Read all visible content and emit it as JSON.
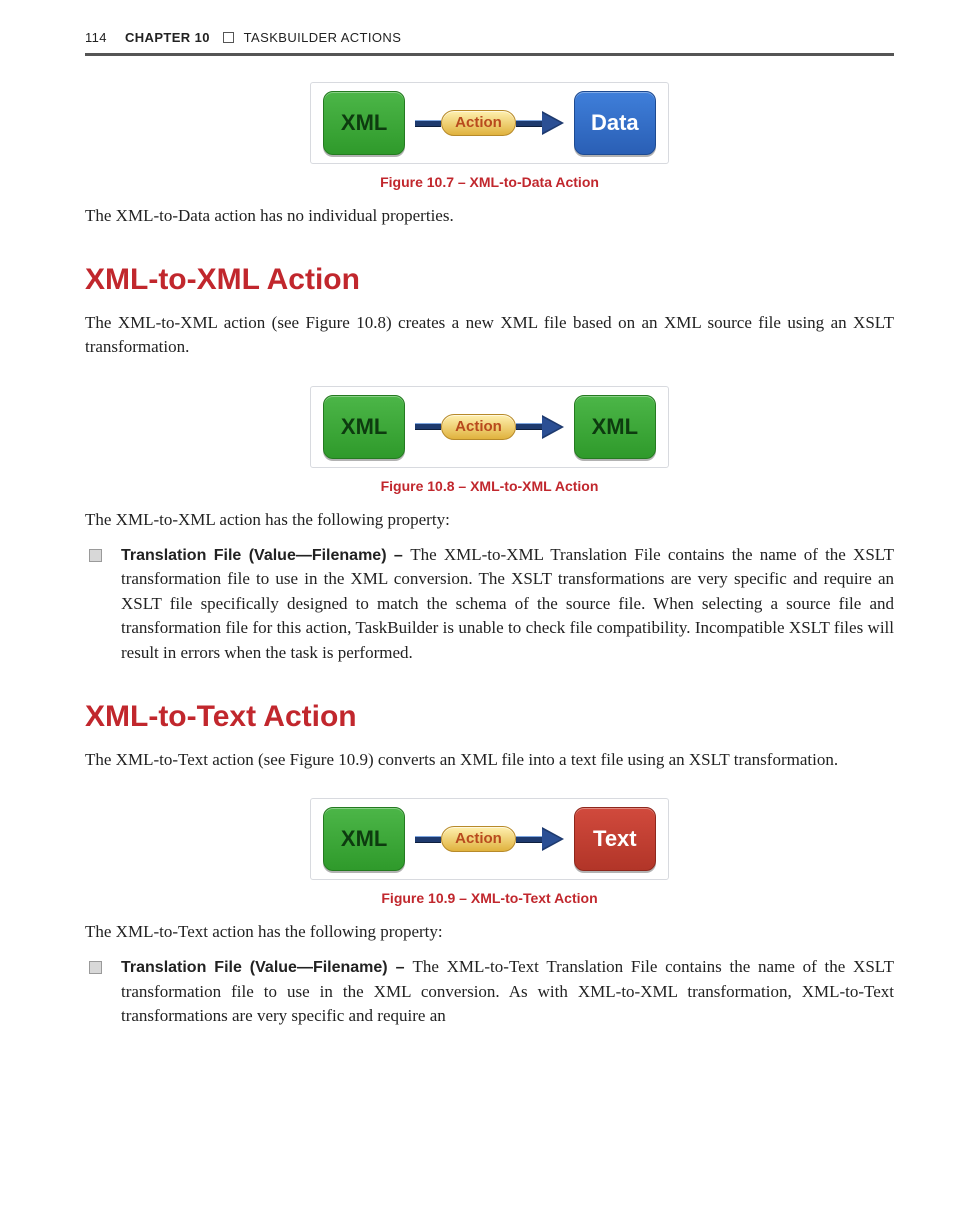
{
  "header": {
    "page_number": "114",
    "chapter_label": "CHAPTER 10",
    "chapter_title": "TASKBUILDER ACTIONS"
  },
  "figure1": {
    "left_box": "XML",
    "pill": "Action",
    "right_box": "Data",
    "caption": "Figure 10.7 – XML-to-Data Action"
  },
  "para1": "The XML-to-Data action has no individual properties.",
  "section1": {
    "heading": "XML-to-XML Action",
    "intro": "The XML-to-XML action (see Figure 10.8) creates a new XML file based on an XML source file using an XSLT transformation."
  },
  "figure2": {
    "left_box": "XML",
    "pill": "Action",
    "right_box": "XML",
    "caption": "Figure 10.8 – XML-to-XML Action"
  },
  "section1_property_lead": "The XML-to-XML action has the following property:",
  "section1_bullet": {
    "term": "Translation File (Value—Filename) – ",
    "text": "The XML-to-XML Translation File contains the name of the XSLT transformation file to use in the XML conversion. The XSLT transformations are very specific and require an XSLT file specifically designed to match the schema of the source file. When selecting a source file and transformation file for this action, TaskBuilder is unable to check file compatibility. Incompatible XSLT files will result in errors when the task is performed."
  },
  "section2": {
    "heading": "XML-to-Text Action",
    "intro": "The XML-to-Text action (see Figure 10.9) converts an XML file into a text file using an XSLT transformation."
  },
  "figure3": {
    "left_box": "XML",
    "pill": "Action",
    "right_box": "Text",
    "caption": "Figure 10.9 – XML-to-Text Action"
  },
  "section2_property_lead": "The XML-to-Text action has the following property:",
  "section2_bullet": {
    "term": "Translation File (Value—Filename) – ",
    "text": "The XML-to-Text Translation File contains the name of the XSLT transformation file to use in the XML conversion. As with XML-to-XML transformation, XML-to-Text transformations are very specific and require an"
  },
  "colors": {
    "accent_red": "#c1272d",
    "tile_green": "#3aa536",
    "tile_blue": "#2f67c1",
    "tile_red": "#c03e32"
  }
}
